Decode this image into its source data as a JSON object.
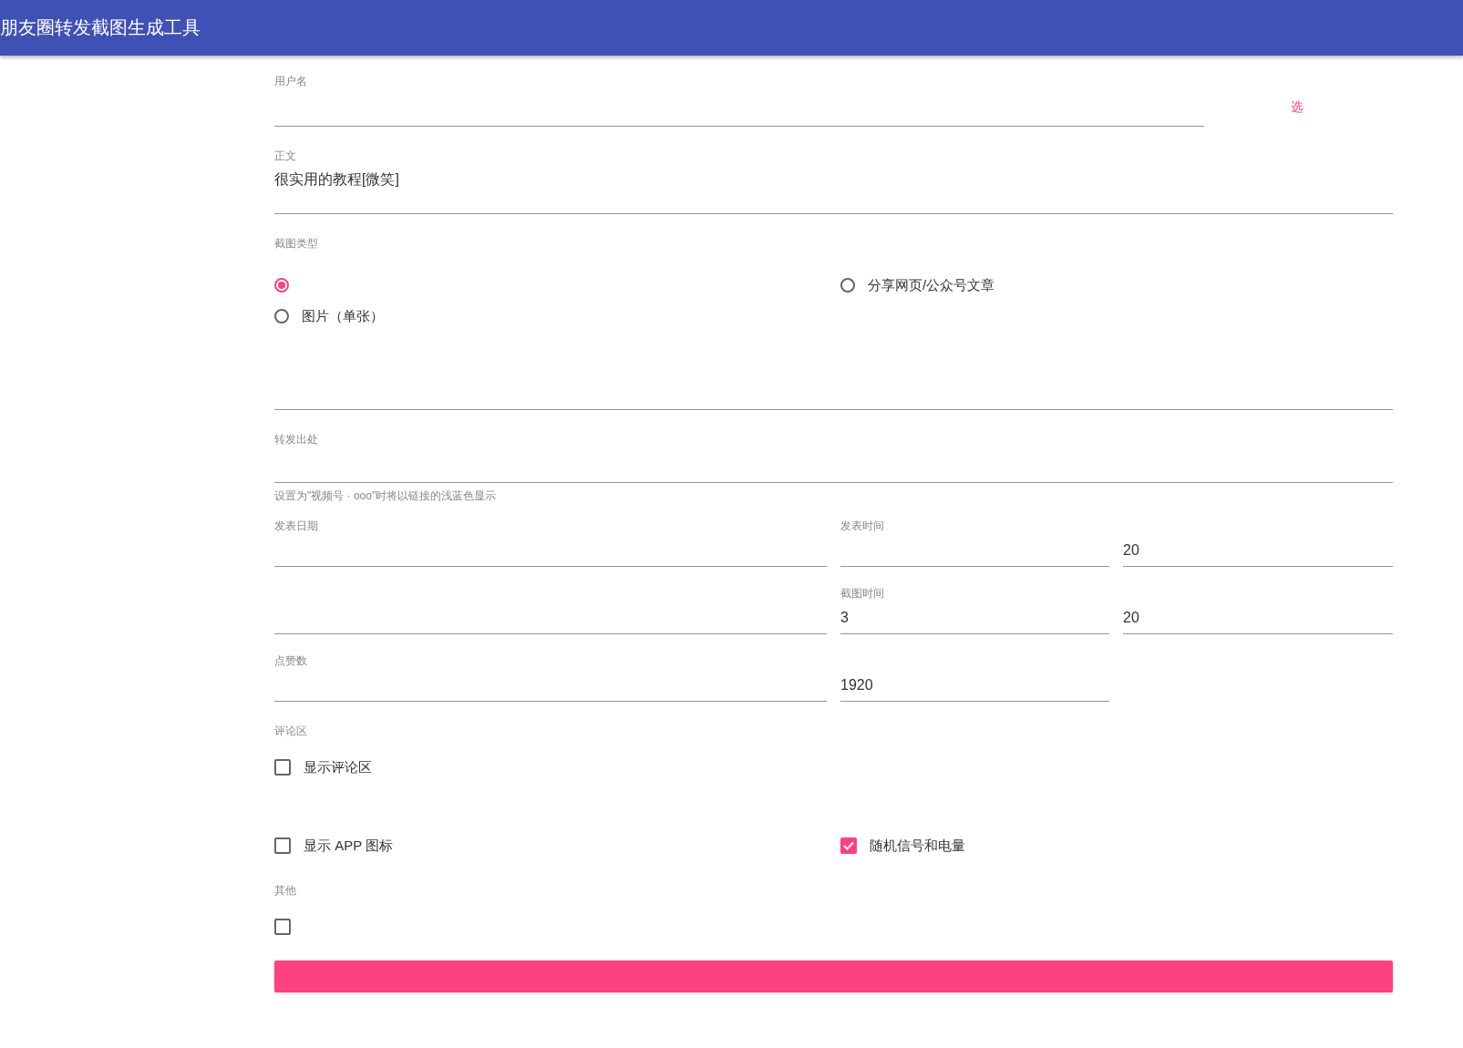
{
  "app_bar": {
    "title": "朋友圈转发截图生成工具"
  },
  "username": {
    "label": "用户名",
    "link": "选"
  },
  "body": {
    "label": "正文",
    "value": "很实用的教程[微笑]"
  },
  "screenshot_type": {
    "label": "截图类型",
    "options": [
      {
        "selected": true
      },
      {
        "label": "分享网页/公众号文章",
        "selected": false
      },
      {
        "label": "图片（单张）",
        "selected": false
      }
    ]
  },
  "forward_source": {
    "label": "转发出处",
    "helper": "设置为\"视频号 · ooo\"时将以链接的浅蓝色显示"
  },
  "publish": {
    "date_label": "发表日期",
    "time_label": "发表时间",
    "minute": "20"
  },
  "capture": {
    "time_label": "截图时间",
    "hour": "3",
    "minute": "20"
  },
  "likes": {
    "label": "点赞数",
    "count": "1920"
  },
  "comments": {
    "label": "评论区",
    "options": [
      {
        "label": "显示评论区",
        "checked": false
      }
    ]
  },
  "display": {
    "options": [
      {
        "label": "显示 APP 图标",
        "checked": false
      },
      {
        "label": "随机信号和电量",
        "checked": true
      }
    ]
  },
  "other": {
    "label": "其他",
    "options": [
      {
        "checked": false
      }
    ]
  }
}
